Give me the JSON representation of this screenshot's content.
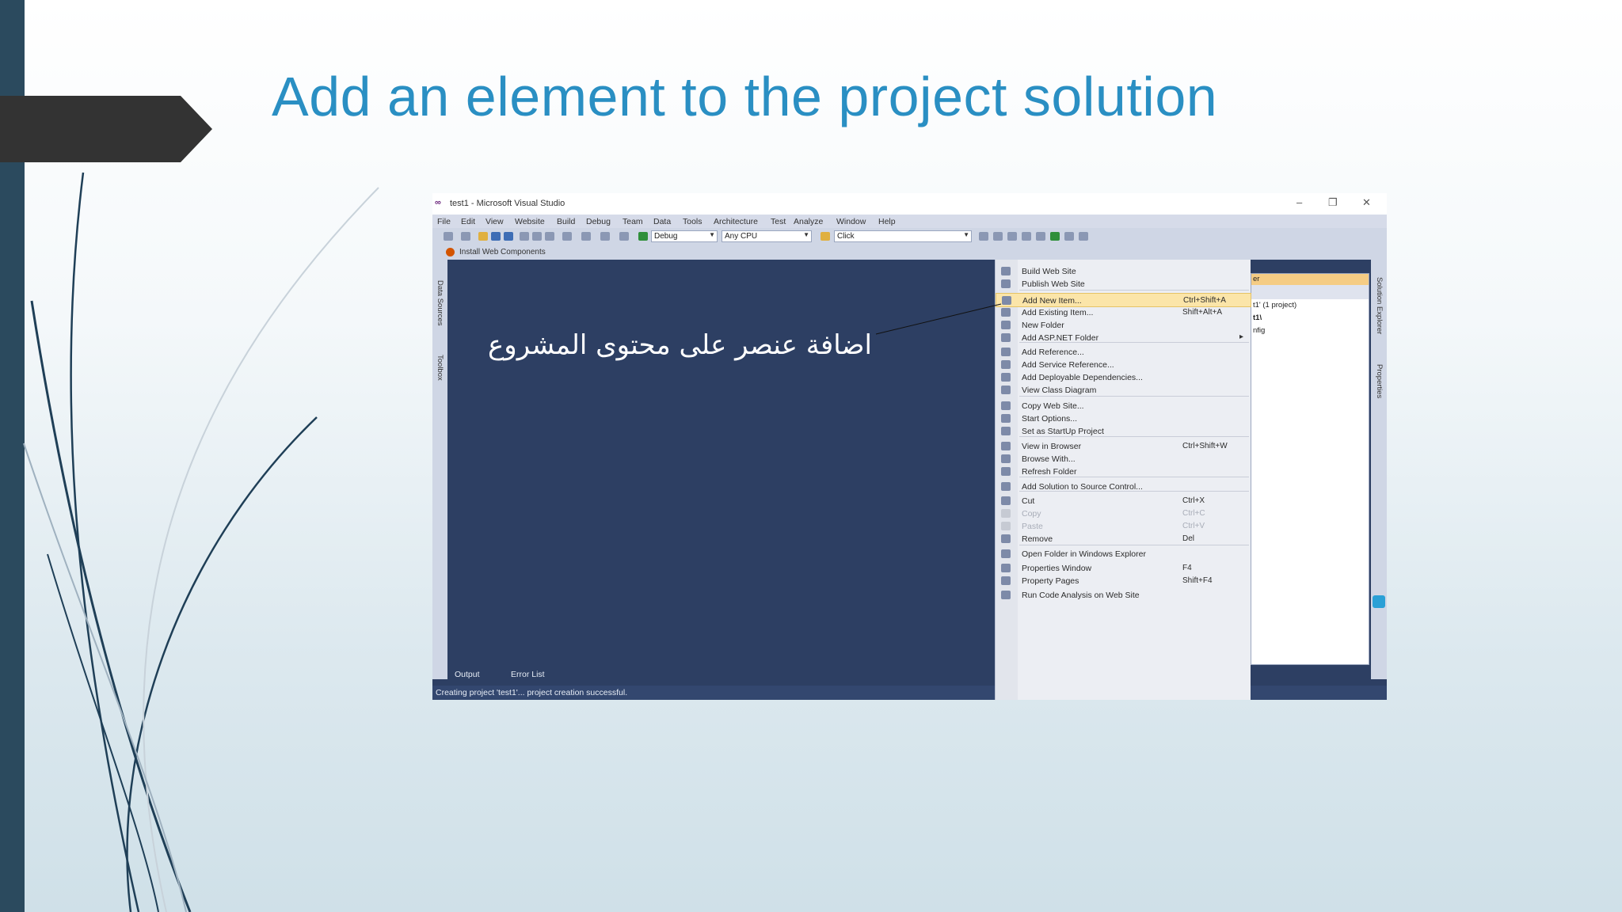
{
  "slide": {
    "title": "Add an element to the project solution"
  },
  "screenshot": {
    "window_title": "test1 - Microsoft Visual Studio",
    "window_controls": {
      "minimize": "–",
      "restore": "❐",
      "close": "✕"
    },
    "menu": [
      "File",
      "Edit",
      "View",
      "Website",
      "Build",
      "Debug",
      "Team",
      "Data",
      "Tools",
      "Architecture",
      "Test",
      "Analyze",
      "Window",
      "Help"
    ],
    "toolbar": {
      "config_combo": "Debug",
      "platform_combo": "Any CPU",
      "find_combo": "Click"
    },
    "toolbar2": {
      "install_label": "Install Web Components"
    },
    "left_strip": {
      "data_sources": "Data Sources",
      "toolbox": "Toolbox"
    },
    "right_strip": {
      "solution_explorer": "Solution Explorer",
      "properties": "Properties"
    },
    "solution_panel": {
      "header": "er",
      "lines": [
        "t1' (1 project)",
        "t1\\",
        "nfig"
      ]
    },
    "overlay_text": "اضافة عنصر على محتوى المشروع",
    "bottom_tabs": {
      "output": "Output",
      "error_list": "Error List"
    },
    "status_text": "Creating project 'test1'... project creation successful.",
    "context_menu": [
      {
        "label": "Build Web Site",
        "shortcut": ""
      },
      {
        "label": "Publish Web Site",
        "shortcut": ""
      },
      {
        "label": "Add New Item...",
        "shortcut": "Ctrl+Shift+A",
        "highlighted": true
      },
      {
        "label": "Add Existing Item...",
        "shortcut": "Shift+Alt+A"
      },
      {
        "label": "New Folder",
        "shortcut": ""
      },
      {
        "label": "Add ASP.NET Folder",
        "shortcut": "",
        "submenu": "▸"
      },
      {
        "label": "Add Reference...",
        "shortcut": ""
      },
      {
        "label": "Add Service Reference...",
        "shortcut": ""
      },
      {
        "label": "Add Deployable Dependencies...",
        "shortcut": ""
      },
      {
        "label": "View Class Diagram",
        "shortcut": ""
      },
      {
        "label": "Copy Web Site...",
        "shortcut": ""
      },
      {
        "label": "Start Options...",
        "shortcut": ""
      },
      {
        "label": "Set as StartUp Project",
        "shortcut": ""
      },
      {
        "label": "View in Browser",
        "shortcut": "Ctrl+Shift+W"
      },
      {
        "label": "Browse With...",
        "shortcut": ""
      },
      {
        "label": "Refresh Folder",
        "shortcut": ""
      },
      {
        "label": "Add Solution to Source Control...",
        "shortcut": ""
      },
      {
        "label": "Cut",
        "shortcut": "Ctrl+X"
      },
      {
        "label": "Copy",
        "shortcut": "Ctrl+C",
        "disabled": true
      },
      {
        "label": "Paste",
        "shortcut": "Ctrl+V",
        "disabled": true
      },
      {
        "label": "Remove",
        "shortcut": "Del"
      },
      {
        "label": "Open Folder in Windows Explorer",
        "shortcut": ""
      },
      {
        "label": "Properties Window",
        "shortcut": "F4"
      },
      {
        "label": "Property Pages",
        "shortcut": "Shift+F4"
      },
      {
        "label": "Run Code Analysis on Web Site",
        "shortcut": ""
      }
    ]
  }
}
